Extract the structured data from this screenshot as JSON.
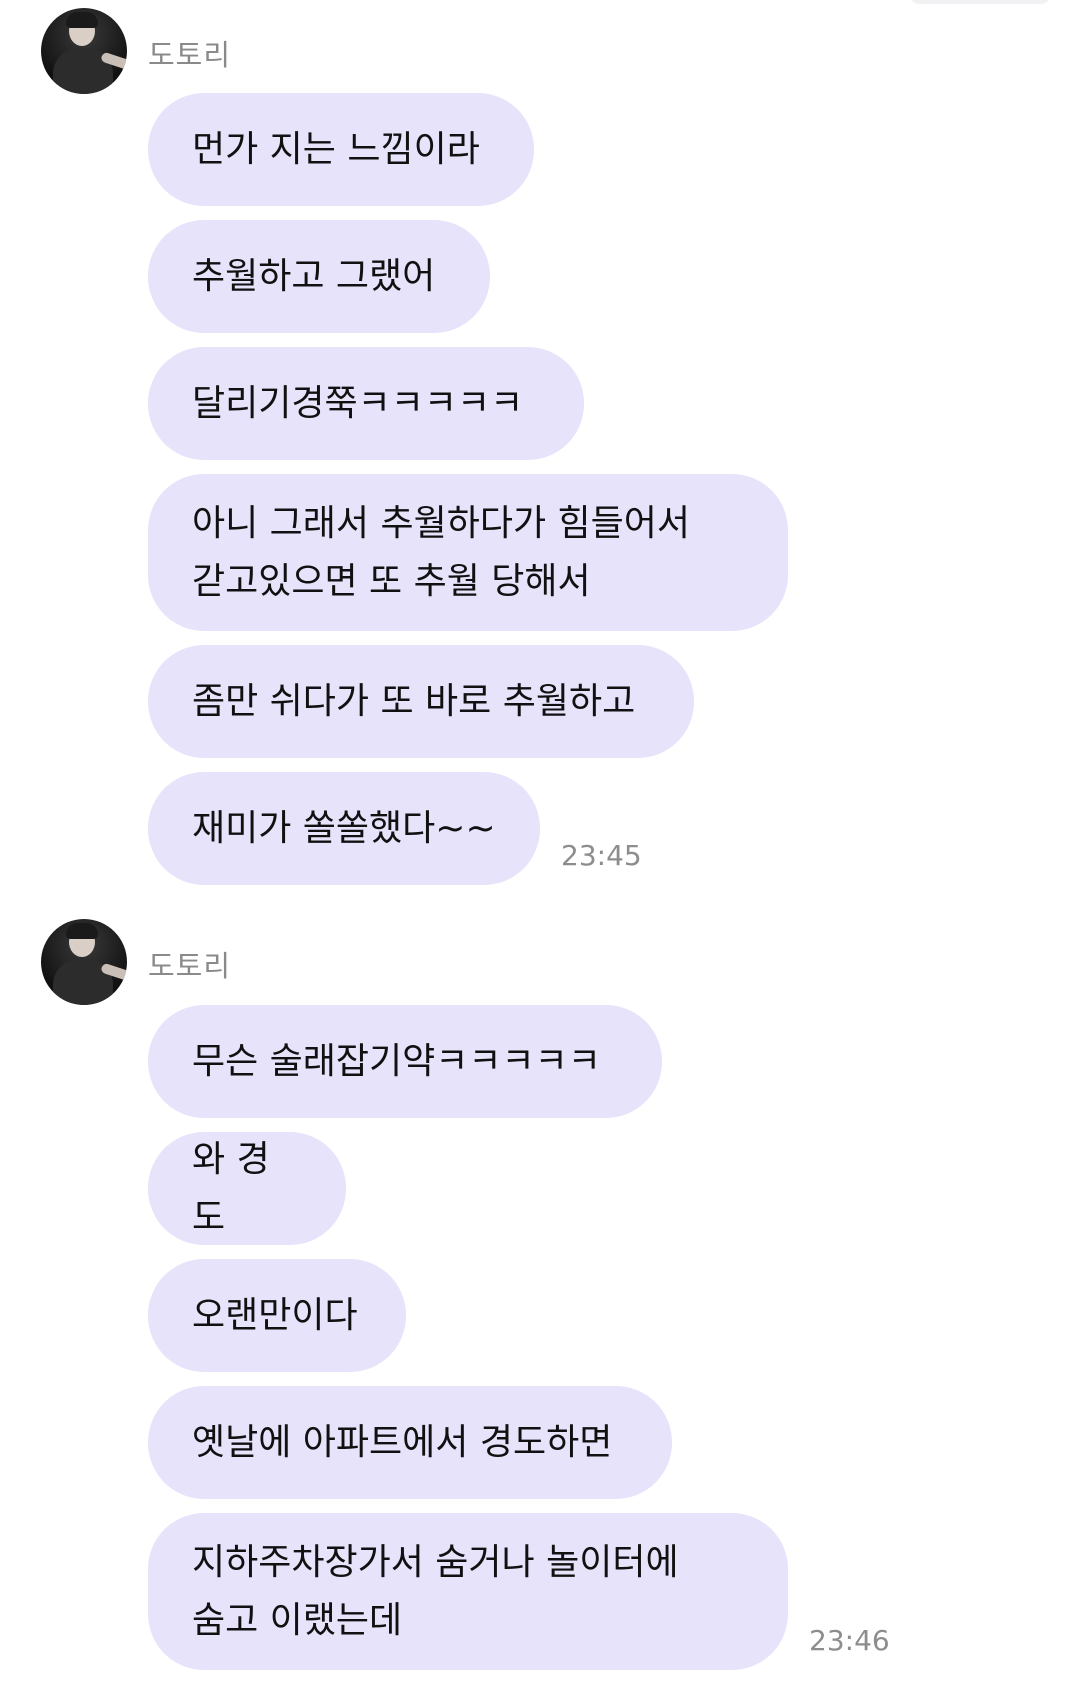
{
  "groups": [
    {
      "sender": "도토리",
      "avatar_icon": "profile-photo-avatar",
      "messages": [
        "먼가 지는 느낌이라",
        "추월하고 그랬어",
        "달리기경쭉ㅋㅋㅋㅋㅋ",
        "아니 그래서 추월하다가 힘들어서\n갇고있으면 또 추월 당해서",
        "좀만 쉬다가 또 바로 추월하고",
        "재미가 쏠쏠했다~~"
      ],
      "time": "23:45"
    },
    {
      "sender": "도토리",
      "avatar_icon": "profile-photo-avatar",
      "messages": [
        "무슨 술래잡기약ㅋㅋㅋㅋㅋ",
        "와 경도",
        "오랜만이다",
        "옛날에 아파트에서 경도하면",
        "지하주차장가서 숨거나 놀이터에\n숨고 이랬는데"
      ],
      "time": "23:46"
    }
  ],
  "colors": {
    "bubble_background": "#e6e3fb",
    "sender_text": "#8a8a8a",
    "timestamp_text": "#8d8d8d"
  }
}
